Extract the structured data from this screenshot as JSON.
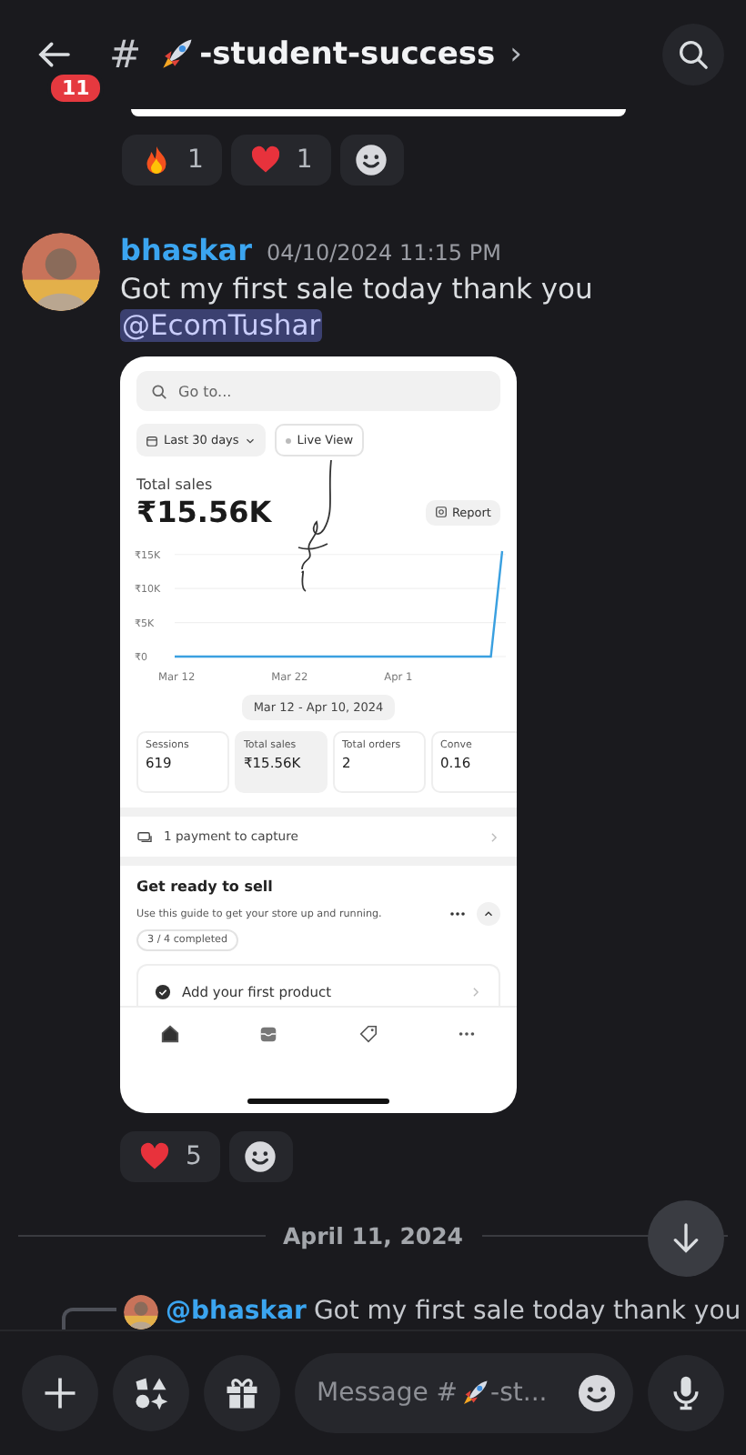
{
  "header": {
    "back_badge": "11",
    "hash": "#",
    "channel": "-student-success",
    "chevron": "›"
  },
  "top_reactions": [
    {
      "kind": "fire",
      "count": "1"
    },
    {
      "kind": "heart",
      "count": "1"
    }
  ],
  "message": {
    "author": "bhaskar",
    "timestamp": "04/10/2024 11:15 PM",
    "text": "Got my first sale today thank you",
    "mention": "@EcomTushar",
    "attachment": {
      "search_placeholder": "Go to...",
      "date_filter": "Last 30 days",
      "live_view": "Live View",
      "metric_label": "Total sales",
      "metric_value": "₹15.56K",
      "report_button": "Report",
      "chart_data": {
        "type": "line",
        "categories": [
          "Mar 12",
          null,
          null,
          null,
          null,
          null,
          null,
          null,
          null,
          null,
          "Mar 22",
          null,
          null,
          null,
          null,
          null,
          null,
          null,
          null,
          null,
          "Apr 1",
          null,
          null,
          null,
          null,
          null,
          null,
          null,
          null,
          null
        ],
        "series": [
          {
            "color": "#3aa0e0",
            "values": [
              0,
              0,
              0,
              0,
              0,
              0,
              0,
              0,
              0,
              0,
              0,
              0,
              0,
              0,
              0,
              0,
              0,
              0,
              0,
              0,
              0,
              0,
              0,
              0,
              0,
              0,
              0,
              0,
              0,
              15500
            ]
          }
        ],
        "ylim": [
          0,
          15500
        ],
        "yticks": [
          {
            "value": 0,
            "label": "₹0"
          },
          {
            "value": 5000,
            "label": "₹5K"
          },
          {
            "value": 10000,
            "label": "₹10K"
          },
          {
            "value": 15000,
            "label": "₹15K"
          }
        ]
      },
      "date_range": "Mar 12 - Apr 10, 2024",
      "stats": [
        {
          "label": "Sessions",
          "value": "619",
          "selected": false
        },
        {
          "label": "Total sales",
          "value": "₹15.56K",
          "selected": true
        },
        {
          "label": "Total orders",
          "value": "2",
          "selected": false
        },
        {
          "label": "Conve",
          "value": "0.16",
          "selected": false
        }
      ],
      "payment_row": "1 payment to capture",
      "guide": {
        "title": "Get ready to sell",
        "text": "Use this guide to get your store up and running.",
        "progress": "3 / 4 completed",
        "task": "Add your first product",
        "task_done": true
      },
      "nav": [
        {
          "kind": "home",
          "selected": true
        },
        {
          "kind": "inbox",
          "selected": false
        },
        {
          "kind": "tag",
          "selected": false
        },
        {
          "kind": "more",
          "selected": false
        }
      ]
    },
    "reactions": [
      {
        "kind": "heart",
        "count": "5"
      }
    ]
  },
  "date_divider": "April 11, 2024",
  "reply_preview": {
    "mention": "@bhaskar",
    "text": "Got my first sale today thank you"
  },
  "composer": {
    "placeholder_prefix": "Message #",
    "placeholder_suffix": "-st..."
  }
}
